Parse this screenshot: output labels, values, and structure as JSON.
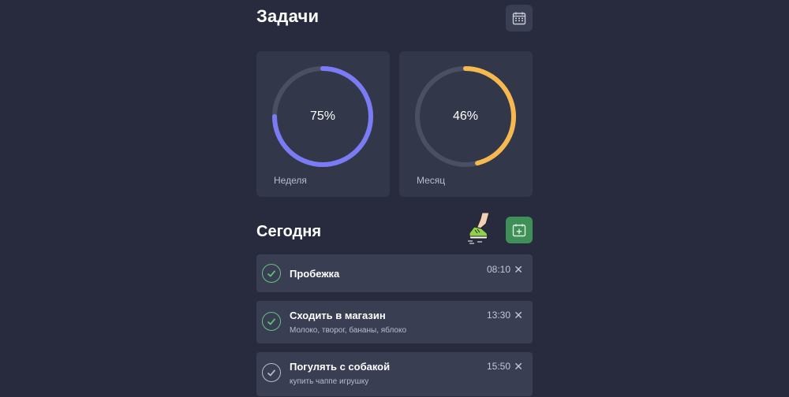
{
  "header": {
    "title": "Задачи",
    "calendar_icon": "calendar-icon"
  },
  "stats": [
    {
      "label": "Неделя",
      "percent_text": "75%",
      "progress": 0.75,
      "color": "#7b7cf5"
    },
    {
      "label": "Месяц",
      "percent_text": "46%",
      "progress": 0.46,
      "color": "#f5b94f"
    }
  ],
  "today": {
    "title": "Сегодня",
    "add_icon": "calendar-plus-icon",
    "accent": "#3f8f58"
  },
  "tasks": [
    {
      "title": "Пробежка",
      "subtitle": "",
      "time": "08:10",
      "done": true
    },
    {
      "title": "Сходить в магазин",
      "subtitle": "Молоко, творог, бананы, яблоко",
      "time": "13:30",
      "done": true
    },
    {
      "title": "Погулять с собакой",
      "subtitle": "купить чаппе игрушку",
      "time": "15:50",
      "done": false
    }
  ],
  "close_symbol": "✕"
}
